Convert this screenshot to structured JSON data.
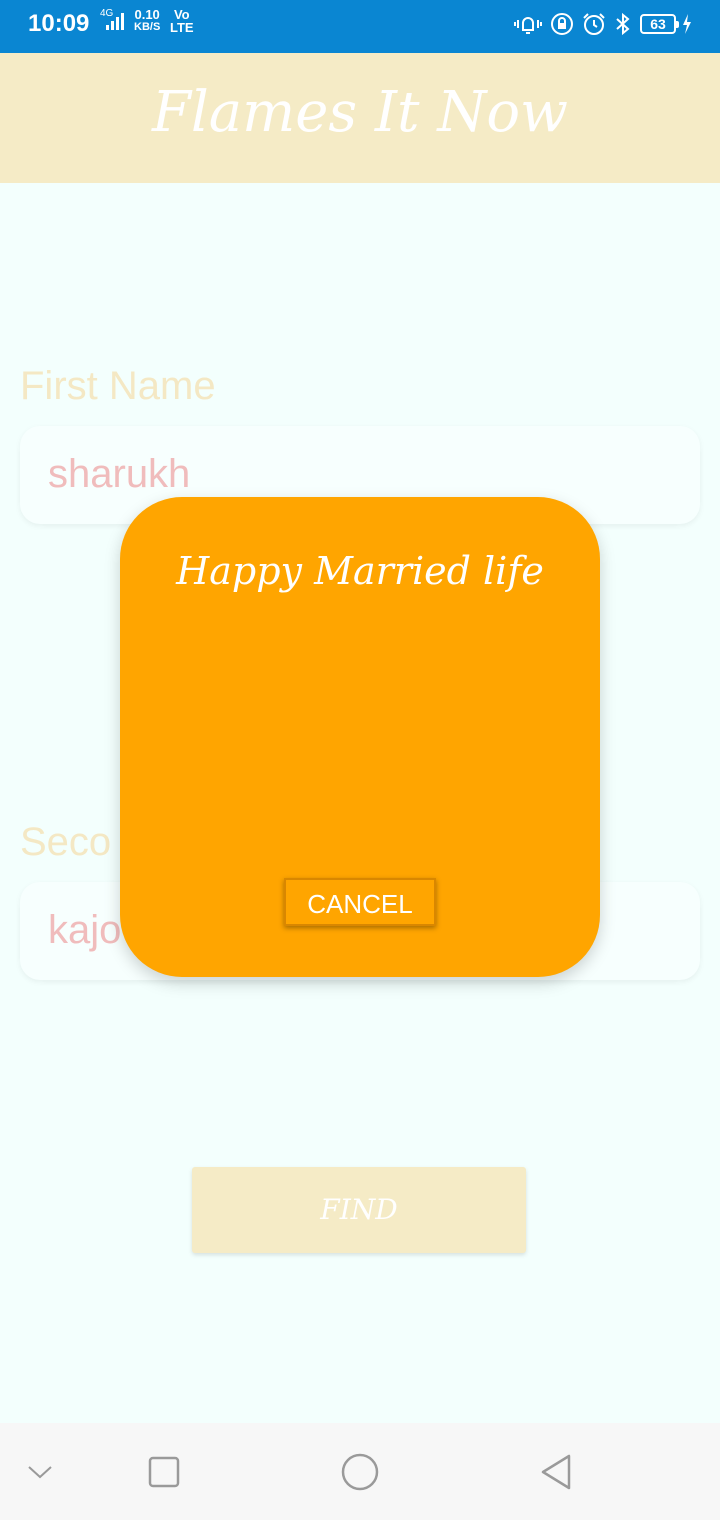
{
  "status_bar": {
    "time": "10:09",
    "network": "4G",
    "speed_value": "0.10",
    "speed_unit": "KB/S",
    "volte_top": "Vo",
    "volte_bottom": "LTE",
    "battery_level": "63",
    "icons": [
      "vibrate-icon",
      "lock-rotation-icon",
      "alarm-icon",
      "bluetooth-icon",
      "battery-icon",
      "charging-icon"
    ]
  },
  "app_bar": {
    "title": "Flames It Now"
  },
  "form": {
    "first_name_label": "First Name",
    "first_name_value": "sharukh",
    "second_name_label": "Seco",
    "second_name_value": "kajo",
    "find_button": "FIND"
  },
  "dialog": {
    "message": "Happy Married life",
    "cancel_button": "CANCEL"
  },
  "nav_bar": {
    "icons": [
      "chevron-down-icon",
      "recents-square-icon",
      "home-circle-icon",
      "back-triangle-icon"
    ]
  },
  "colors": {
    "status_bar": "#0a86d2",
    "app_bar": "#f5ebc6",
    "background": "#f3fffd",
    "dialog": "#ffa500",
    "input_text": "#f0bcbc"
  }
}
